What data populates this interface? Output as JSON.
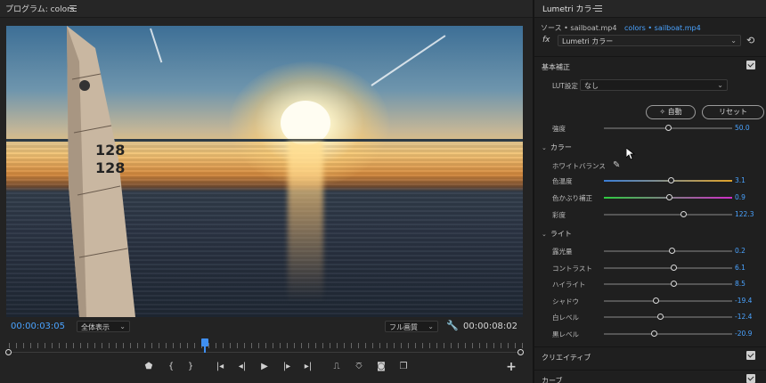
{
  "program_monitor": {
    "title": "プログラム: colors",
    "menu_icon": "hamburger-icon",
    "timecode_current": "00:00:03:05",
    "timecode_duration": "00:00:08:02",
    "zoom_select": "全体表示",
    "quality_select": "フル画質",
    "sail_numbers": [
      "128",
      "128"
    ],
    "playhead_fraction": 0.38,
    "transport_icons": [
      "marker-icon",
      "in-point-icon",
      "out-point-icon",
      "go-to-in-icon",
      "step-back-icon",
      "play-icon",
      "step-forward-icon",
      "go-to-out-icon",
      "lift-icon",
      "extract-icon",
      "export-frame-icon",
      "compare-view-icon",
      "add-button-icon"
    ],
    "transport_glyphs": {
      "marker": "⬟",
      "in": "{",
      "out": "}",
      "go_in": "|◂",
      "step_back": "◂|",
      "play": "▶",
      "step_fwd": "|▸",
      "go_out": "▸|",
      "lift": "⎍",
      "extract": "⎏",
      "camera": "◙",
      "compare": "❐",
      "add": "+"
    }
  },
  "lumetri": {
    "title": "Lumetri カラー",
    "source_clip": "ソース • sailboat.mp4",
    "active_clip": "colors • sailboat.mp4",
    "fx_label": "fx",
    "effect_select": "Lumetri カラー",
    "basic_section": {
      "label": "基本補正",
      "checked": true,
      "lut_label": "LUT設定",
      "lut_value": "なし",
      "auto_label": "自動",
      "reset_label": "リセット",
      "intensity": {
        "label": "強度",
        "value": "50.0",
        "position": 0.5
      }
    },
    "color_section": {
      "label": "カラー",
      "white_balance_label": "ホワイトバランス",
      "sliders": [
        {
          "label": "色温度",
          "value": "3.1",
          "position": 0.52,
          "gradient": "temperature"
        },
        {
          "label": "色かぶり補正",
          "value": "0.9",
          "position": 0.51,
          "gradient": "tint"
        },
        {
          "label": "彩度",
          "value": "122.3",
          "position": 0.62,
          "gradient": "none"
        }
      ]
    },
    "light_section": {
      "label": "ライト",
      "sliders": [
        {
          "label": "露光量",
          "value": "0.2",
          "position": 0.53
        },
        {
          "label": "コントラスト",
          "value": "6.1",
          "position": 0.54
        },
        {
          "label": "ハイライト",
          "value": "8.5",
          "position": 0.54
        },
        {
          "label": "シャドウ",
          "value": "-19.4",
          "position": 0.4
        },
        {
          "label": "白レベル",
          "value": "-12.4",
          "position": 0.44
        },
        {
          "label": "黒レベル",
          "value": "-20.9",
          "position": 0.39
        }
      ]
    },
    "creative_section": {
      "label": "クリエイティブ",
      "checked": true
    },
    "curves_section": {
      "label": "カーブ",
      "checked": true
    },
    "colors": {
      "accent": "#4aa3ff",
      "panel": "#1f1f1f",
      "temp_left": "#3a7dd6",
      "temp_right": "#e0a32a",
      "tint_left": "#2ecc40",
      "tint_right": "#d02ec8"
    }
  }
}
